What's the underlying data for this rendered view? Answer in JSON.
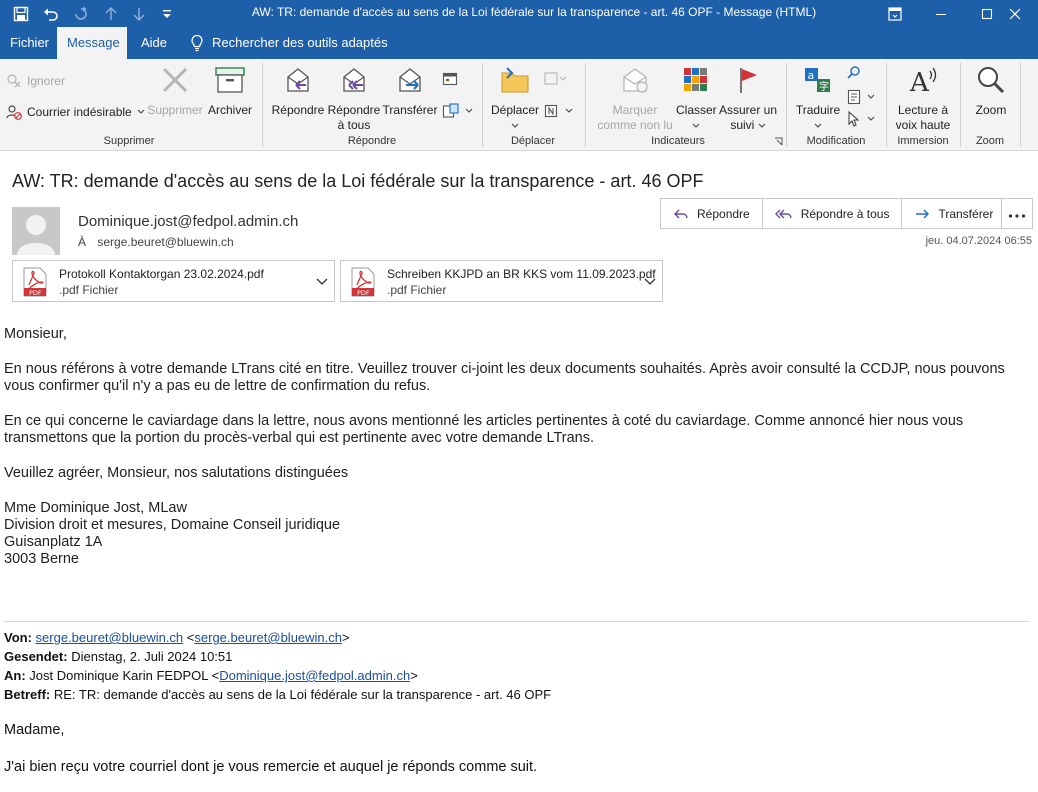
{
  "window": {
    "title": "AW: TR: demande d'accès au sens de la Loi fédérale sur la transparence - art. 46 OPF  -  Message (HTML)"
  },
  "tabs": [
    {
      "label": "Fichier"
    },
    {
      "label": "Message",
      "active": true
    },
    {
      "label": "Aide"
    }
  ],
  "search": {
    "label": "Rechercher des outils adaptés"
  },
  "ribbon": {
    "ignore": "Ignorer",
    "junk": "Courrier indésirable",
    "delete": "Supprimer",
    "archive": "Archiver",
    "reply": "Répondre",
    "reply_all_1": "Répondre",
    "reply_all_2": "à tous",
    "forward": "Transférer",
    "move": "Déplacer",
    "mark_1": "Marquer",
    "mark_2": "comme non lu",
    "classify": "Classer",
    "followup_1": "Assurer un",
    "followup_2": "suivi",
    "translate": "Traduire",
    "read_1": "Lecture à",
    "read_2": "voix haute",
    "zoom": "Zoom",
    "groups": {
      "delete": "Supprimer",
      "respond": "Répondre",
      "move": "Déplacer",
      "tags": "Indicateurs",
      "edit": "Modification",
      "immersive": "Immersion",
      "zoom": "Zoom"
    }
  },
  "message": {
    "subject": "AW: TR: demande d'accès au sens de la Loi fédérale sur la transparence - art. 46 OPF",
    "sender": "Dominique.jost@fedpol.admin.ch",
    "to_label": "À",
    "to": "serge.beuret@bluewin.ch",
    "date": "jeu. 04.07.2024 06:55",
    "actions": {
      "reply": "Répondre",
      "reply_all": "Répondre à tous",
      "forward": "Transférer"
    },
    "attachments": [
      {
        "name": "Protokoll Kontaktorgan 23.02.2024.pdf",
        "type": ".pdf Fichier"
      },
      {
        "name": "Schreiben KKJPD an BR KKS vom 11.09.2023.pdf",
        "type": ".pdf Fichier"
      }
    ]
  },
  "body": {
    "greeting": "Monsieur,",
    "p1": "En nous référons à votre demande LTrans cité en titre. Veuillez trouver ci-joint les deux documents souhaités. Après avoir consulté la CCDJP, nous pouvons vous confirmer qu'il n'y a pas eu de lettre de confirmation du refus.",
    "p2": "En ce qui concerne le caviardage dans la lettre, nous avons mentionné les articles pertinentes à coté du caviardage. Comme annoncé hier nous vous transmettons que la portion du procès-verbal qui est pertinente avec votre demande LTrans.",
    "closing": "Veuillez agréer, Monsieur, nos salutations distinguées",
    "sig": [
      "Mme Dominique Jost, MLaw",
      "Division droit et mesures, Domaine Conseil juridique",
      "Guisanplatz 1A",
      "3003 Berne"
    ]
  },
  "forwarded": {
    "from_label": "Von:",
    "from": "serge.beuret@bluewin.ch",
    "from_bracket": "serge.beuret@bluewin.ch",
    "sent_label": "Gesendet:",
    "sent": "Dienstag, 2. Juli 2024 10:51",
    "to_label": "An:",
    "to_name": "Jost Dominique Karin FEDPOL",
    "to_email": "Dominique.jost@fedpol.admin.ch",
    "subject_label": "Betreff:",
    "subject": "RE: TR: demande d'accès au sens de la Loi fédérale sur la transparence - art. 46 OPF",
    "greeting": "Madame,",
    "line1": "J'ai bien reçu votre courriel dont je vous remercie et auquel je réponds comme suit."
  },
  "colors": {
    "titlebar": "#1d5fa9",
    "ribbon": "#f3f3f3",
    "link": "#1a4fa0"
  },
  "icons": {
    "save": "save-icon",
    "undo": "undo-icon",
    "pdf": "pdf-icon",
    "lightbulb": "lightbulb-icon"
  }
}
